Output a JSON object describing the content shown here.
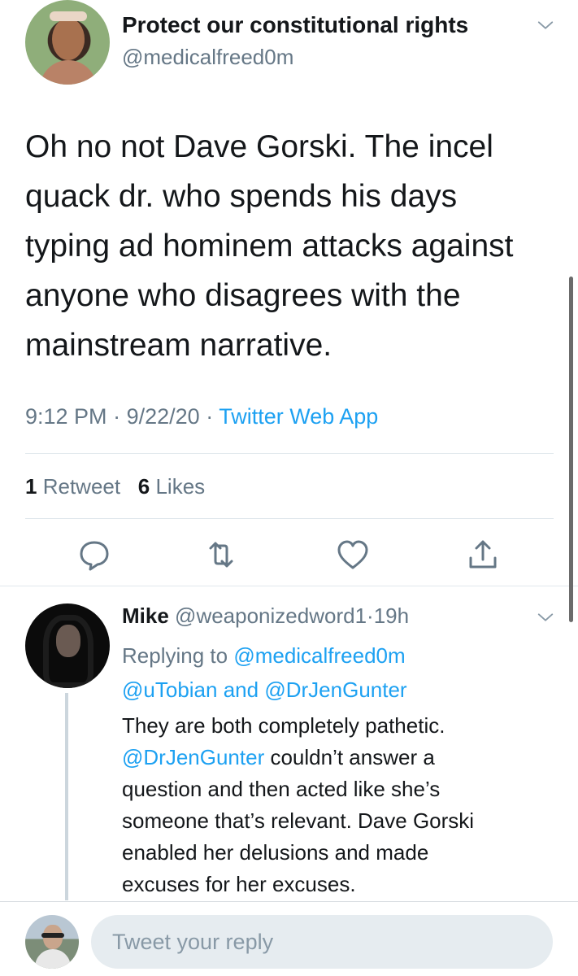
{
  "tweet": {
    "display_name": "Protect our constitutional rights",
    "handle": "@medicalfreed0m",
    "text_lines": [
      "Oh no not Dave Gorski. The incel",
      "quack dr. who spends his days",
      "typing ad hominem attacks against",
      "anyone who disagrees with the",
      "mainstream narrative."
    ],
    "time": "9:12 PM",
    "separator": "·",
    "date": "9/22/20",
    "source": "Twitter Web App",
    "retweet_count": "1",
    "retweet_label": "Retweet",
    "like_count": "6",
    "like_label": "Likes",
    "actions": [
      "reply-icon",
      "retweet-icon",
      "like-icon",
      "share-icon"
    ]
  },
  "reply": {
    "name": "Mike",
    "handle": "@weaponizedword1",
    "separator": "·",
    "age": "19h",
    "replying_prefix": "Replying to",
    "replying_to_1": "@medicalfreed0m",
    "replying_to_2": "@uTobian",
    "replying_and": "and",
    "replying_to_3": "@DrJenGunter",
    "line1": "They are both completely pathetic.",
    "mention": "@DrJenGunter",
    "line2_rest": " couldn’t answer a",
    "line3": "question and then acted like she’s",
    "line4": "someone that’s relevant. Dave Gorski",
    "line5": "enabled her delusions and made",
    "line6": "excuses for her excuses."
  },
  "composer": {
    "placeholder": "Tweet your reply"
  },
  "colors": {
    "link": "#1da1f2",
    "secondary_text": "#657786",
    "primary_text": "#14171a",
    "divider": "#e1e8ed"
  }
}
